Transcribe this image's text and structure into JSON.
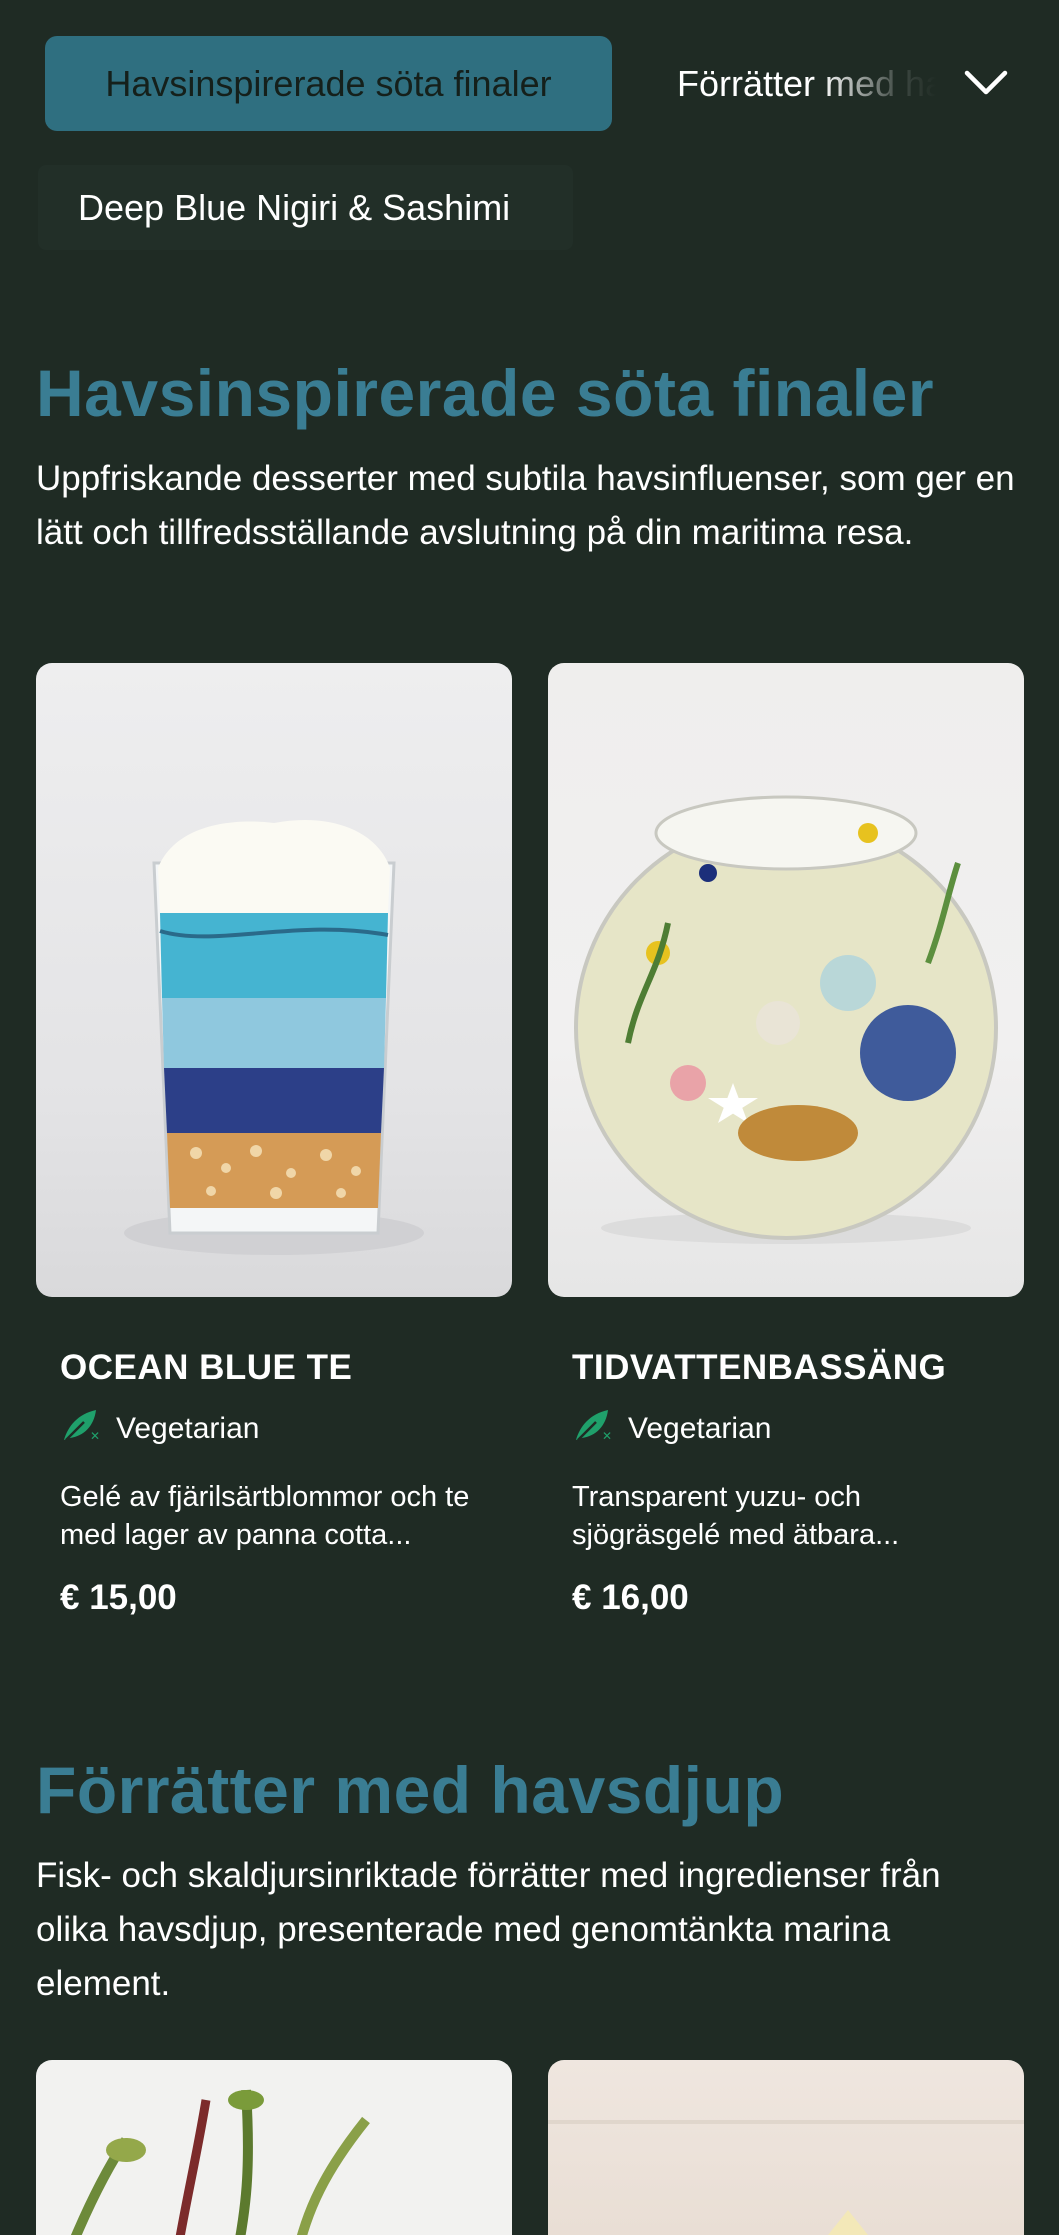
{
  "category_nav": {
    "active": "Havsinspirerade söta finaler",
    "next": "Förrätter med havsdjup",
    "toggle_icon": "chevron-down-icon",
    "second_row": "Deep Blue Nigiri & Sashimi"
  },
  "sections": [
    {
      "title": "Havsinspirerade söta finaler",
      "description": "Uppfriskande desserter med subtila havsinfluenser, som ger en lätt och tillfredsställande avslutning på din maritima resa.",
      "items": [
        {
          "name": "OCEAN BLUE TE",
          "diet": "Vegetarian",
          "diet_icon": "vegetarian-leaf-icon",
          "description": "Gelé av fjärilsärtblommor och te med lager av panna cotta...",
          "price": "€ 15,00"
        },
        {
          "name": "TIDVATTENBASSÄNG",
          "diet": "Vegetarian",
          "diet_icon": "vegetarian-leaf-icon",
          "description": "Transparent yuzu- och sjögräsgelé med ätbara...",
          "price": "€ 16,00"
        }
      ]
    },
    {
      "title": "Förrätter med havsdjup",
      "description": "Fisk- och skaldjursinriktade förrätter med ingredienser från olika havsdjup, presenterade med genomtänkta marina element.",
      "items": []
    }
  ],
  "colors": {
    "background": "#1f2b24",
    "accent": "#3a7d93",
    "active_chip": "#2f6f80",
    "veg_icon": "#1fa06b"
  }
}
